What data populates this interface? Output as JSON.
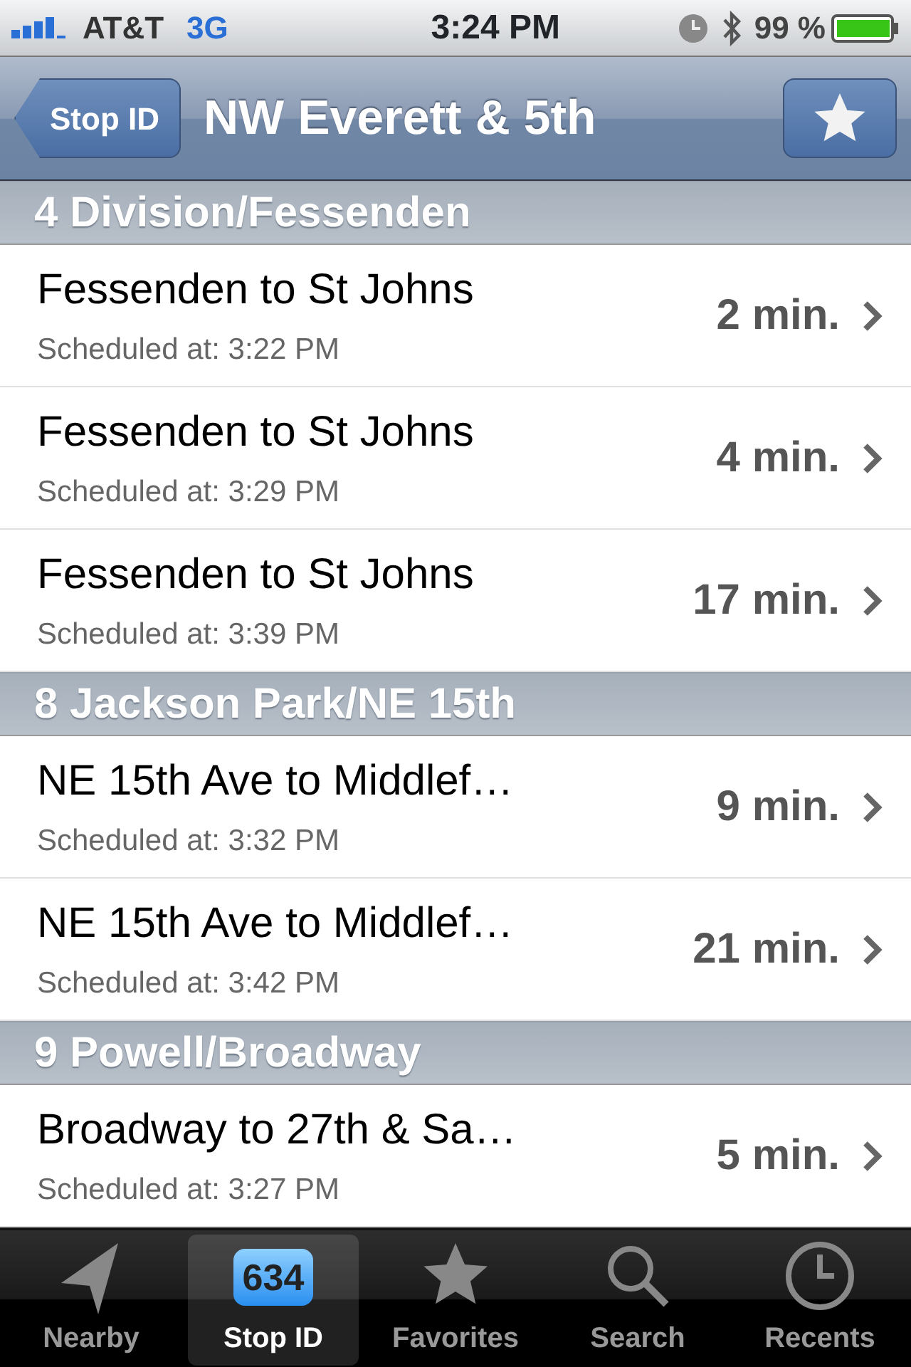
{
  "status_bar": {
    "carrier": "AT&T",
    "network": "3G",
    "time": "3:24 PM",
    "battery": "99 %"
  },
  "nav_bar": {
    "back": "Stop ID",
    "title": "NW Everett & 5th"
  },
  "sections": [
    {
      "title": "4 Division/Fessenden",
      "rows": [
        {
          "destination": "Fessenden to St Johns",
          "scheduled": "Scheduled at: 3:22 PM",
          "eta": "2 min."
        },
        {
          "destination": "Fessenden to St Johns",
          "scheduled": "Scheduled at: 3:29 PM",
          "eta": "4 min."
        },
        {
          "destination": "Fessenden to St Johns",
          "scheduled": "Scheduled at: 3:39 PM",
          "eta": "17 min."
        }
      ]
    },
    {
      "title": "8 Jackson Park/NE 15th",
      "rows": [
        {
          "destination": "NE 15th Ave to Middlef…",
          "scheduled": "Scheduled at: 3:32 PM",
          "eta": "9 min."
        },
        {
          "destination": "NE 15th Ave to Middlef…",
          "scheduled": "Scheduled at: 3:42 PM",
          "eta": "21 min."
        }
      ]
    },
    {
      "title": "9 Powell/Broadway",
      "rows": [
        {
          "destination": "Broadway to 27th & Sa…",
          "scheduled": "Scheduled at: 3:27 PM",
          "eta": "5 min."
        }
      ]
    }
  ],
  "tab_bar": [
    {
      "kind": "nearby",
      "label": "Nearby",
      "selected": false
    },
    {
      "kind": "stopid",
      "label": "Stop ID",
      "badge": "634",
      "selected": true
    },
    {
      "kind": "favorites",
      "label": "Favorites",
      "selected": false
    },
    {
      "kind": "search",
      "label": "Search",
      "selected": false
    },
    {
      "kind": "recents",
      "label": "Recents",
      "selected": false
    }
  ]
}
